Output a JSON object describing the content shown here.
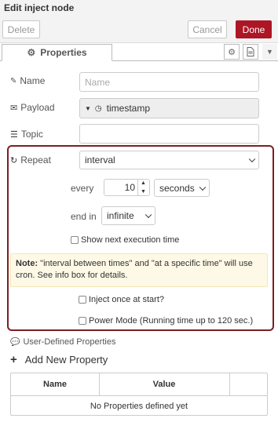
{
  "title": "Edit inject node",
  "toolbar": {
    "delete_label": "Delete",
    "cancel_label": "Cancel",
    "done_label": "Done",
    "done_color": "#ad1625"
  },
  "tabs": {
    "properties_label": "Properties"
  },
  "form": {
    "name_label": "Name",
    "name_placeholder": "Name",
    "payload_label": "Payload",
    "payload_value": "timestamp",
    "topic_label": "Topic",
    "topic_value": ""
  },
  "repeat": {
    "label": "Repeat",
    "mode": "interval",
    "every_label": "every",
    "every_value": "10",
    "unit": "seconds",
    "end_in_label": "end in",
    "end_in_value": "infinite",
    "show_next_label": "Show next execution time",
    "note_bold": "Note:",
    "note_text": " \"interval between times\" and \"at a specific time\" will use cron. See info box for details.",
    "inject_once_label": "Inject once at start?",
    "power_mode_label": "Power Mode (Running time up to 120 sec.)",
    "accent_border": "#7a1f22"
  },
  "user_props": {
    "heading": "User-Defined Properties",
    "add_label": "Add New Property",
    "col_name": "Name",
    "col_value": "Value",
    "empty_text": "No Properties defined yet"
  },
  "icons": [
    "gear-icon",
    "document-icon",
    "caret-down-icon",
    "tag-icon",
    "envelope-icon",
    "list-icon",
    "refresh-icon",
    "clock-icon",
    "plus-icon",
    "comment-icon"
  ]
}
